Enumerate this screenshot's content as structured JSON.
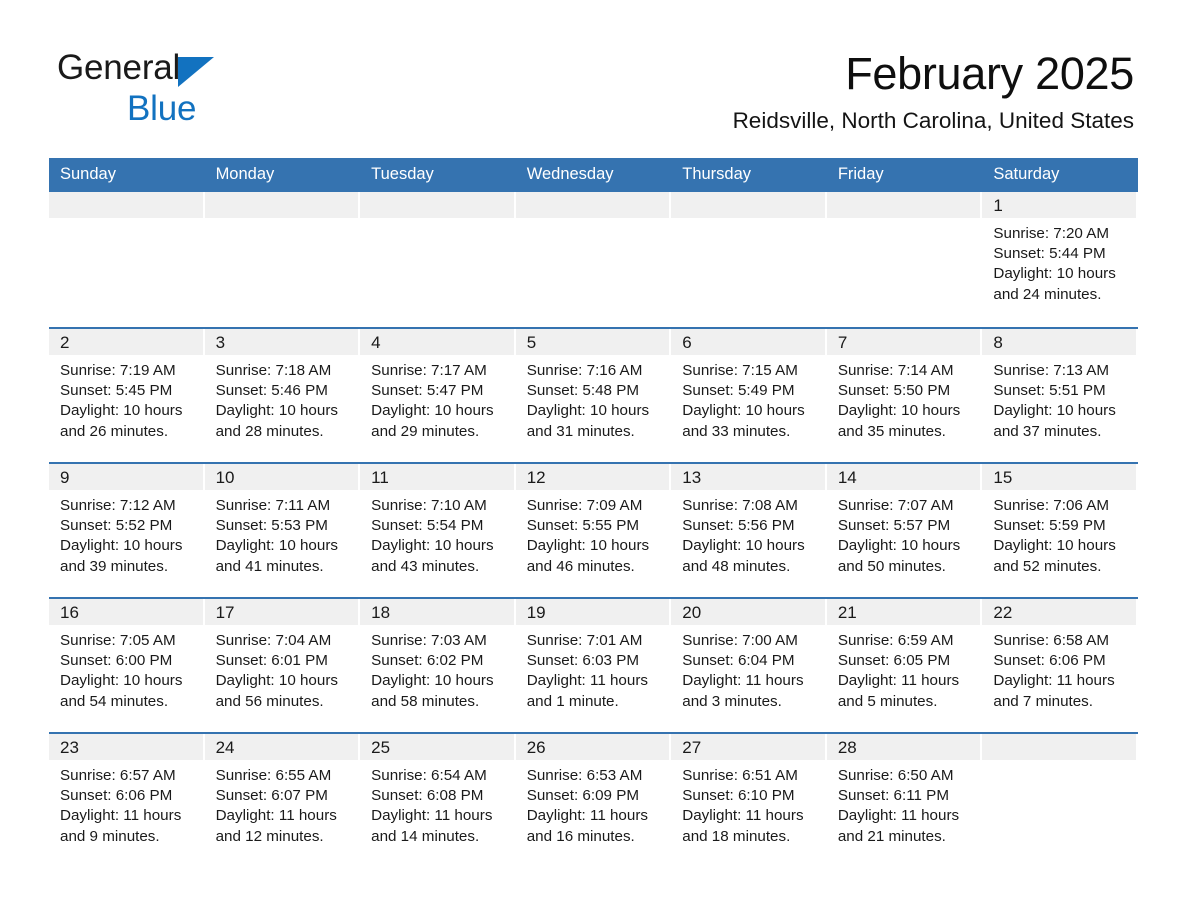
{
  "brand": {
    "name_part1": "General",
    "name_part2": "Blue",
    "triangle_color": "#1272c0",
    "text_color": "#1a1a1a"
  },
  "header": {
    "title": "February 2025",
    "location": "Reidsville, North Carolina, United States"
  },
  "theme": {
    "header_blue": "#3573b0",
    "row_divider_blue": "#3573b0",
    "daynum_band_gray": "#f0f0f0",
    "page_background": "#ffffff",
    "text_color": "#1a1a1a"
  },
  "weekday_headers": [
    "Sunday",
    "Monday",
    "Tuesday",
    "Wednesday",
    "Thursday",
    "Friday",
    "Saturday"
  ],
  "weeks": [
    [
      {
        "day": "",
        "empty": true
      },
      {
        "day": "",
        "empty": true
      },
      {
        "day": "",
        "empty": true
      },
      {
        "day": "",
        "empty": true
      },
      {
        "day": "",
        "empty": true
      },
      {
        "day": "",
        "empty": true
      },
      {
        "day": "1",
        "sunrise": "Sunrise: 7:20 AM",
        "sunset": "Sunset: 5:44 PM",
        "daylight": "Daylight: 10 hours and 24 minutes."
      }
    ],
    [
      {
        "day": "2",
        "sunrise": "Sunrise: 7:19 AM",
        "sunset": "Sunset: 5:45 PM",
        "daylight": "Daylight: 10 hours and 26 minutes."
      },
      {
        "day": "3",
        "sunrise": "Sunrise: 7:18 AM",
        "sunset": "Sunset: 5:46 PM",
        "daylight": "Daylight: 10 hours and 28 minutes."
      },
      {
        "day": "4",
        "sunrise": "Sunrise: 7:17 AM",
        "sunset": "Sunset: 5:47 PM",
        "daylight": "Daylight: 10 hours and 29 minutes."
      },
      {
        "day": "5",
        "sunrise": "Sunrise: 7:16 AM",
        "sunset": "Sunset: 5:48 PM",
        "daylight": "Daylight: 10 hours and 31 minutes."
      },
      {
        "day": "6",
        "sunrise": "Sunrise: 7:15 AM",
        "sunset": "Sunset: 5:49 PM",
        "daylight": "Daylight: 10 hours and 33 minutes."
      },
      {
        "day": "7",
        "sunrise": "Sunrise: 7:14 AM",
        "sunset": "Sunset: 5:50 PM",
        "daylight": "Daylight: 10 hours and 35 minutes."
      },
      {
        "day": "8",
        "sunrise": "Sunrise: 7:13 AM",
        "sunset": "Sunset: 5:51 PM",
        "daylight": "Daylight: 10 hours and 37 minutes."
      }
    ],
    [
      {
        "day": "9",
        "sunrise": "Sunrise: 7:12 AM",
        "sunset": "Sunset: 5:52 PM",
        "daylight": "Daylight: 10 hours and 39 minutes."
      },
      {
        "day": "10",
        "sunrise": "Sunrise: 7:11 AM",
        "sunset": "Sunset: 5:53 PM",
        "daylight": "Daylight: 10 hours and 41 minutes."
      },
      {
        "day": "11",
        "sunrise": "Sunrise: 7:10 AM",
        "sunset": "Sunset: 5:54 PM",
        "daylight": "Daylight: 10 hours and 43 minutes."
      },
      {
        "day": "12",
        "sunrise": "Sunrise: 7:09 AM",
        "sunset": "Sunset: 5:55 PM",
        "daylight": "Daylight: 10 hours and 46 minutes."
      },
      {
        "day": "13",
        "sunrise": "Sunrise: 7:08 AM",
        "sunset": "Sunset: 5:56 PM",
        "daylight": "Daylight: 10 hours and 48 minutes."
      },
      {
        "day": "14",
        "sunrise": "Sunrise: 7:07 AM",
        "sunset": "Sunset: 5:57 PM",
        "daylight": "Daylight: 10 hours and 50 minutes."
      },
      {
        "day": "15",
        "sunrise": "Sunrise: 7:06 AM",
        "sunset": "Sunset: 5:59 PM",
        "daylight": "Daylight: 10 hours and 52 minutes."
      }
    ],
    [
      {
        "day": "16",
        "sunrise": "Sunrise: 7:05 AM",
        "sunset": "Sunset: 6:00 PM",
        "daylight": "Daylight: 10 hours and 54 minutes."
      },
      {
        "day": "17",
        "sunrise": "Sunrise: 7:04 AM",
        "sunset": "Sunset: 6:01 PM",
        "daylight": "Daylight: 10 hours and 56 minutes."
      },
      {
        "day": "18",
        "sunrise": "Sunrise: 7:03 AM",
        "sunset": "Sunset: 6:02 PM",
        "daylight": "Daylight: 10 hours and 58 minutes."
      },
      {
        "day": "19",
        "sunrise": "Sunrise: 7:01 AM",
        "sunset": "Sunset: 6:03 PM",
        "daylight": "Daylight: 11 hours and 1 minute."
      },
      {
        "day": "20",
        "sunrise": "Sunrise: 7:00 AM",
        "sunset": "Sunset: 6:04 PM",
        "daylight": "Daylight: 11 hours and 3 minutes."
      },
      {
        "day": "21",
        "sunrise": "Sunrise: 6:59 AM",
        "sunset": "Sunset: 6:05 PM",
        "daylight": "Daylight: 11 hours and 5 minutes."
      },
      {
        "day": "22",
        "sunrise": "Sunrise: 6:58 AM",
        "sunset": "Sunset: 6:06 PM",
        "daylight": "Daylight: 11 hours and 7 minutes."
      }
    ],
    [
      {
        "day": "23",
        "sunrise": "Sunrise: 6:57 AM",
        "sunset": "Sunset: 6:06 PM",
        "daylight": "Daylight: 11 hours and 9 minutes."
      },
      {
        "day": "24",
        "sunrise": "Sunrise: 6:55 AM",
        "sunset": "Sunset: 6:07 PM",
        "daylight": "Daylight: 11 hours and 12 minutes."
      },
      {
        "day": "25",
        "sunrise": "Sunrise: 6:54 AM",
        "sunset": "Sunset: 6:08 PM",
        "daylight": "Daylight: 11 hours and 14 minutes."
      },
      {
        "day": "26",
        "sunrise": "Sunrise: 6:53 AM",
        "sunset": "Sunset: 6:09 PM",
        "daylight": "Daylight: 11 hours and 16 minutes."
      },
      {
        "day": "27",
        "sunrise": "Sunrise: 6:51 AM",
        "sunset": "Sunset: 6:10 PM",
        "daylight": "Daylight: 11 hours and 18 minutes."
      },
      {
        "day": "28",
        "sunrise": "Sunrise: 6:50 AM",
        "sunset": "Sunset: 6:11 PM",
        "daylight": "Daylight: 11 hours and 21 minutes."
      },
      {
        "day": "",
        "empty": true
      }
    ]
  ]
}
